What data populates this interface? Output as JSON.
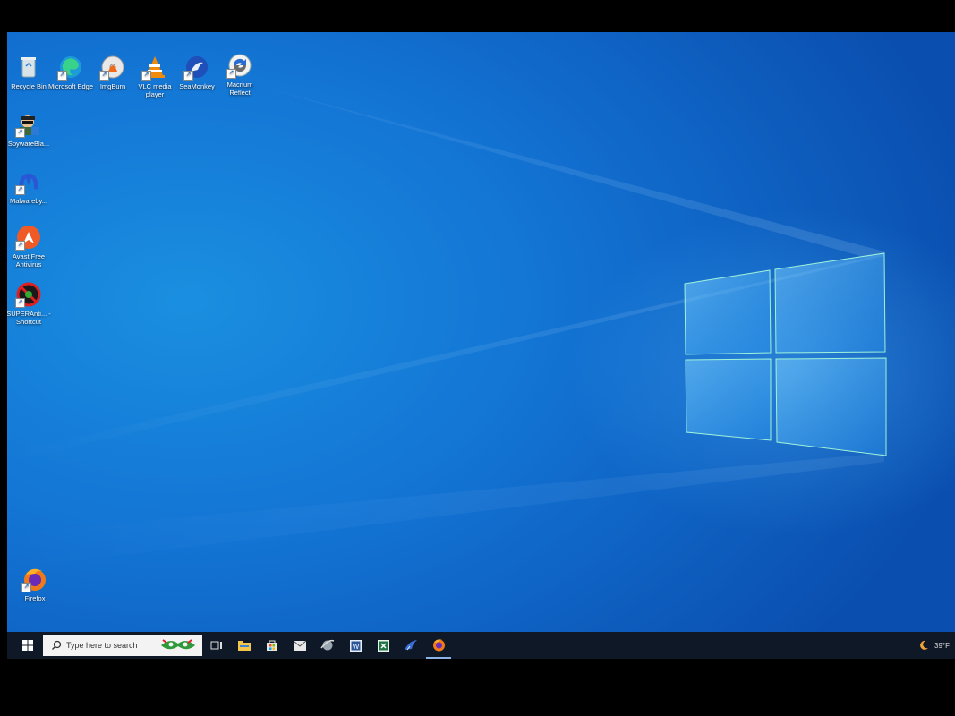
{
  "desktop": {
    "icons": [
      {
        "label": "Recycle Bin",
        "icon": "recycle-bin-icon"
      },
      {
        "label": "Microsoft Edge",
        "icon": "edge-icon"
      },
      {
        "label": "ImgBurn",
        "icon": "imgburn-icon"
      },
      {
        "label": "VLC media player",
        "icon": "vlc-icon"
      },
      {
        "label": "SeaMonkey",
        "icon": "seamonkey-icon"
      },
      {
        "label": "Macrium Reflect",
        "icon": "macrium-icon"
      },
      {
        "label": "SpywareBla...",
        "icon": "spywareblaster-icon"
      },
      {
        "label": "Malwareby...",
        "icon": "malwarebytes-icon"
      },
      {
        "label": "Avast Free Antivirus",
        "icon": "avast-icon"
      },
      {
        "label": "SUPERAnti... - Shortcut",
        "icon": "superantispyware-icon"
      },
      {
        "label": "Firefox",
        "icon": "firefox-icon"
      }
    ]
  },
  "taskbar": {
    "search_placeholder": "Type here to search",
    "pinned": [
      "task-view-icon",
      "file-explorer-icon",
      "store-icon",
      "mail-icon",
      "browser-icon",
      "word-icon",
      "excel-icon",
      "seamonkey-icon",
      "firefox-icon"
    ],
    "weather_temp": "39°F",
    "weather_icon": "moon-icon"
  },
  "colors": {
    "desktop_blue": "#1374d4",
    "taskbar": "#0e1826"
  }
}
